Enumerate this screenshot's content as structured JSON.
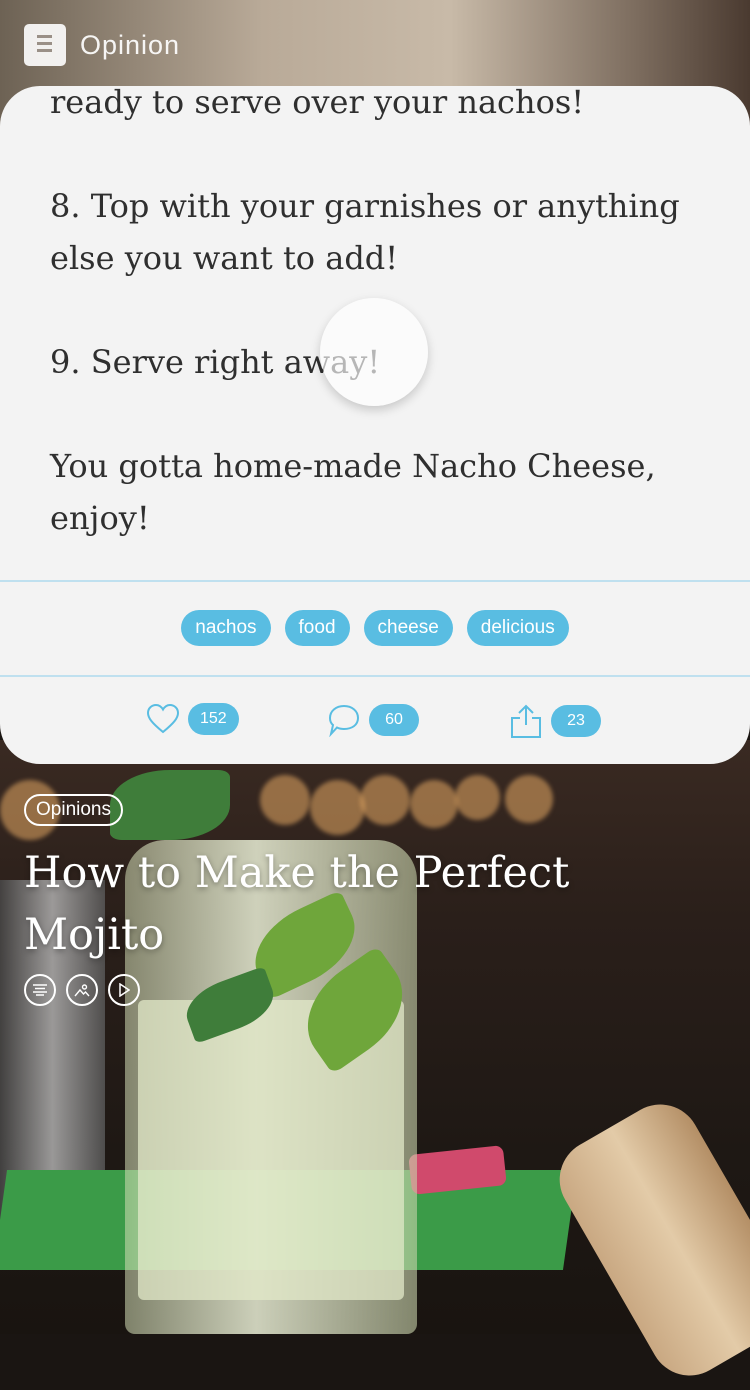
{
  "header": {
    "title": "Opinion",
    "icon": "article-icon"
  },
  "article": {
    "paragraphs": [
      "ready to serve over your nachos!",
      "8. Top with your garnishes or anything else you want to add!",
      "9. Serve right away!",
      "You gotta home-made Nacho Cheese, enjoy!"
    ]
  },
  "tags": [
    "nachos",
    "food",
    "cheese",
    "delicious"
  ],
  "actions": {
    "likes": "152",
    "comments": "60",
    "shares": "23"
  },
  "next_story": {
    "category": "Opinions",
    "title": "How to Make the Perfect Mojito",
    "content_types": [
      "text-icon",
      "image-icon",
      "video-icon"
    ]
  },
  "colors": {
    "accent": "#59bde2",
    "card_bg": "#f3f3f3",
    "divider": "#bfe0ef"
  }
}
